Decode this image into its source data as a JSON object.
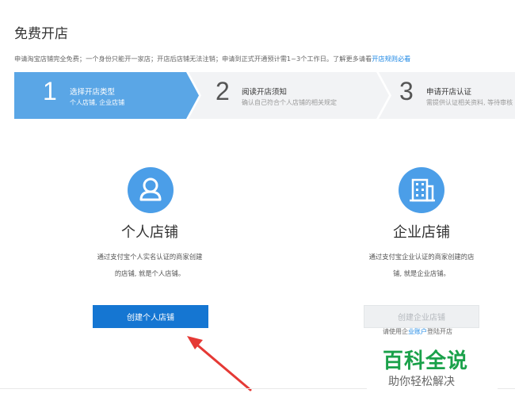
{
  "page": {
    "title": "免费开店",
    "intro_text": "申请淘宝店铺完全免费；一个身份只能开一家店；开店后店铺无法注销；申请到正式开通预计需1~3个工作日。了解更多请看",
    "intro_link": "开店规则必看"
  },
  "steps": [
    {
      "num": "1",
      "title": "选择开店类型",
      "subtitle": "个人店铺, 企业店铺",
      "active": true
    },
    {
      "num": "2",
      "title": "阅读开店须知",
      "subtitle": "确认自己符合个人店铺的相关规定",
      "active": false
    },
    {
      "num": "3",
      "title": "申请开店认证",
      "subtitle": "需提供认证相关资料, 等待审核",
      "active": false
    }
  ],
  "personal": {
    "icon": "person-icon",
    "name": "个人店铺",
    "desc_line1": "通过支付宝个人实名认证的商家创建",
    "desc_line2": "的店铺, 就是个人店铺。",
    "button": "创建个人店铺"
  },
  "enterprise": {
    "icon": "building-icon",
    "name": "企业店铺",
    "desc_line1": "通过支付宝企业认证的商家创建的店",
    "desc_line2": "铺, 就是企业店铺。",
    "button": "创建企业店铺",
    "partial_note_prefix": "请使用企",
    "partial_note_link": "业账户",
    "partial_note_suffix": "登陆开店"
  },
  "watermark": {
    "main": "百科全说",
    "sub": "助你轻松解决"
  },
  "colors": {
    "accent": "#1576d2",
    "step_active": "#5aa6e6",
    "step_inactive": "#f2f3f5",
    "icon_bg": "#4b9ee8",
    "arrow": "#e53935",
    "watermark": "#1aa14a"
  }
}
